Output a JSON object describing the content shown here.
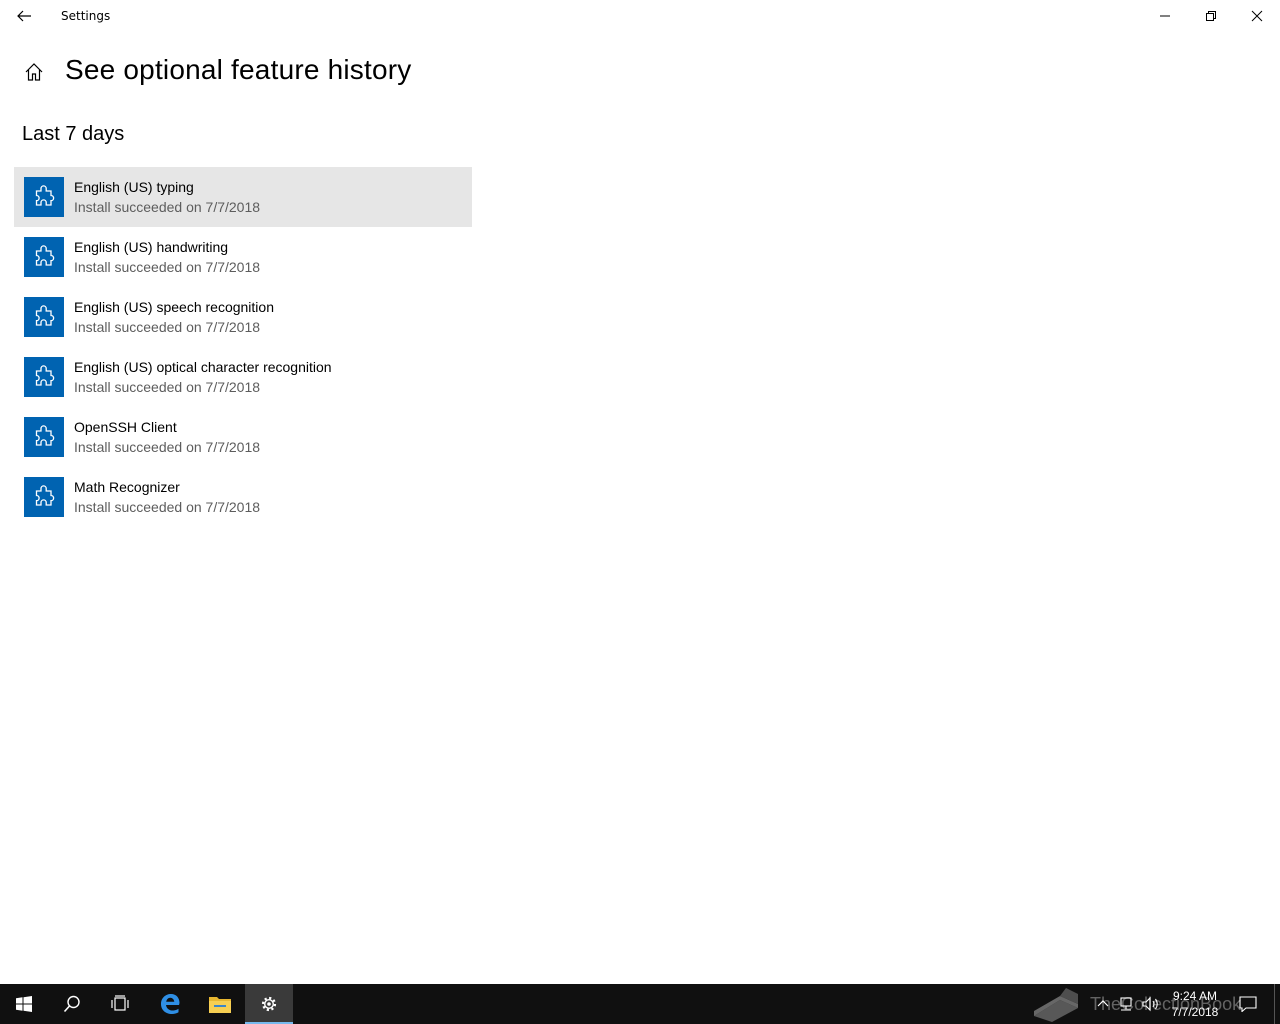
{
  "window": {
    "title": "Settings"
  },
  "header": {
    "page_title": "See optional feature history",
    "section_title": "Last 7 days"
  },
  "features": [
    {
      "name": "English (US) typing",
      "status": "Install succeeded on 7/7/2018"
    },
    {
      "name": "English (US) handwriting",
      "status": "Install succeeded on 7/7/2018"
    },
    {
      "name": "English (US) speech recognition",
      "status": "Install succeeded on 7/7/2018"
    },
    {
      "name": "English (US) optical character recognition",
      "status": "Install succeeded on 7/7/2018"
    },
    {
      "name": "OpenSSH Client",
      "status": "Install succeeded on 7/7/2018"
    },
    {
      "name": "Math Recognizer",
      "status": "Install succeeded on 7/7/2018"
    }
  ],
  "taskbar": {
    "clock_time": "9:24 AM",
    "clock_date": "7/7/2018",
    "watermark_text": "TheCollectionBook"
  },
  "icons": {
    "back": "back-arrow-icon",
    "home": "home-icon",
    "feature": "puzzle-piece-icon",
    "minimize": "minimize-icon",
    "maximize": "restore-icon",
    "close": "close-icon",
    "start": "windows-start-icon",
    "search": "search-icon",
    "task_view": "task-view-icon",
    "edge": "edge-icon",
    "explorer": "file-explorer-icon",
    "settings": "gear-icon"
  },
  "colors": {
    "accent": "#0063b1",
    "hover_row": "#e6e6e6",
    "taskbar": "#101010",
    "secondary_text": "#5d5d5d"
  }
}
